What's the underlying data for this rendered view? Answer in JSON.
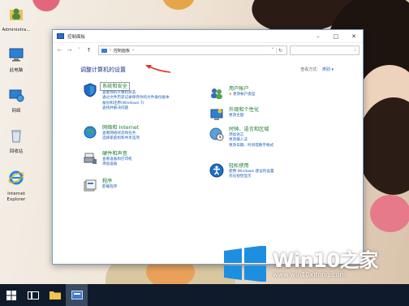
{
  "desktop": {
    "icons": [
      {
        "label": "Administra...",
        "icon": "user-folder-icon"
      },
      {
        "label": "此电脑",
        "icon": "computer-icon"
      },
      {
        "label": "网络",
        "icon": "network-icon"
      },
      {
        "label": "回收站",
        "icon": "recycle-bin-icon"
      },
      {
        "label": "Internet Explorer",
        "icon": "ie-icon"
      }
    ]
  },
  "window": {
    "title": "控制面板",
    "breadcrumb": "控制面板",
    "search_placeholder": "",
    "heading": "调整计算机的设置",
    "view_by_label": "查看方式:",
    "view_by_value": "类别 ▾",
    "categories": [
      {
        "title": "系统和安全",
        "icon": "shield-icon",
        "links": [
          "查看你的计算机状态",
          "通过文件历史记录保存你的文件备份副本",
          "备份和还原(Windows 7)",
          "查找并解决问题"
        ]
      },
      {
        "title": "网络和 Internet",
        "icon": "network-globe-icon",
        "links": [
          "查看网络状态和任务",
          "选择家庭组和共享选项"
        ]
      },
      {
        "title": "硬件和声音",
        "icon": "printer-icon",
        "links": [
          "查看设备和打印机",
          "添加设备"
        ]
      },
      {
        "title": "程序",
        "icon": "programs-icon",
        "links": [
          "卸载程序"
        ]
      },
      {
        "title": "用户帐户",
        "icon": "users-icon",
        "links": [
          "更改帐户类型"
        ]
      },
      {
        "title": "外观和个性化",
        "icon": "appearance-icon",
        "links": [
          "更改主题"
        ]
      },
      {
        "title": "时钟、语言和区域",
        "icon": "clock-globe-icon",
        "links": [
          "添加语言",
          "更改输入法",
          "更改日期、时间或数字格式"
        ]
      },
      {
        "title": "轻松使用",
        "icon": "ease-of-access-icon",
        "links": [
          "使用 Windows 建议的设置",
          "优化视觉显示"
        ]
      }
    ]
  },
  "watermark": {
    "brand": "Win10之家",
    "url": "www.win10xitong.com"
  },
  "taskbar": {
    "items": [
      "start-icon",
      "task-view-icon",
      "file-explorer-icon",
      "control-panel-icon"
    ]
  },
  "colors": {
    "category_title": "#1a7b2e",
    "link": "#1a5fb4",
    "heading": "#1e3287",
    "taskbar": "#0f1a2a"
  }
}
